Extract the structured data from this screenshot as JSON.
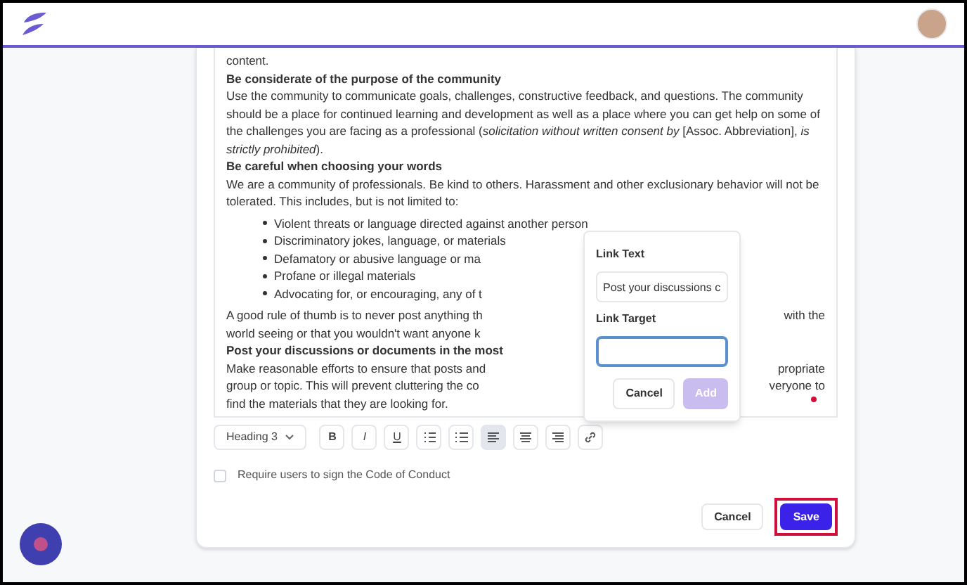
{
  "editor": {
    "blocks": [
      {
        "kind": "text",
        "text": "content."
      },
      {
        "kind": "heading",
        "text": "Be considerate of the purpose of the community"
      },
      {
        "kind": "text",
        "text": "Use the community to communicate goals, challenges, constructive feedback, and questions. The community should be a place for continued learning and development as well as a place where you can get help on some of the challenges you are facing as a professional (*solicitation without written consent by* [Assoc. Abbreviation], *is strictly prohibited*)."
      },
      {
        "kind": "heading",
        "text": "Be careful when choosing your words"
      },
      {
        "kind": "text",
        "text": "We are a community of professionals. Be kind to others. Harassment and other exclusionary behavior will not be tolerated. This includes, but is not limited to:"
      },
      {
        "kind": "list",
        "items": [
          "Violent threats or language directed against another person",
          "Discriminatory jokes, language, or materials",
          "Defamatory or abusive language or ma",
          "Profane or illegal materials",
          "Advocating for, or encouraging, any of t"
        ]
      },
      {
        "kind": "split",
        "left": "A good rule of thumb is to never post anything th",
        "right": "with the"
      },
      {
        "kind": "split",
        "left": "world seeing or that you wouldn't want anyone k"
      },
      {
        "kind": "split_heading",
        "left": "Post your discussions or documents in the most"
      },
      {
        "kind": "split",
        "left": "Make reasonable efforts to ensure that posts and",
        "right": "propriate"
      },
      {
        "kind": "split",
        "left": "group or topic. This will prevent cluttering the co",
        "right": "veryone to"
      },
      {
        "kind": "split",
        "left": "find the materials that they are looking for."
      }
    ]
  },
  "link_popover": {
    "link_text_label": "Link Text",
    "link_text_value": "Post your discussions c",
    "link_target_label": "Link Target",
    "cancel": "Cancel",
    "add": {
      "label": "Add",
      "disabled": true
    }
  },
  "toolbar": [
    {
      "kind": "select",
      "label": "Heading 3",
      "selected": false
    },
    {
      "kind": "bold",
      "label": "B",
      "selected": false
    },
    {
      "kind": "italic",
      "label": "I",
      "selected": false
    },
    {
      "kind": "underline",
      "label": "U",
      "selected": false
    },
    {
      "kind": "ordered",
      "selected": false
    },
    {
      "kind": "bullets",
      "selected": false
    },
    {
      "kind": "align_left",
      "selected": true
    },
    {
      "kind": "align_center",
      "selected": false
    },
    {
      "kind": "align_right",
      "selected": false
    },
    {
      "kind": "link",
      "selected": false
    }
  ],
  "require_checkbox": {
    "label": "Require users to sign the Code of Conduct",
    "checked": false
  },
  "buttons": {
    "cancel": "Cancel",
    "save": {
      "label": "Save",
      "highlighted": true
    }
  }
}
